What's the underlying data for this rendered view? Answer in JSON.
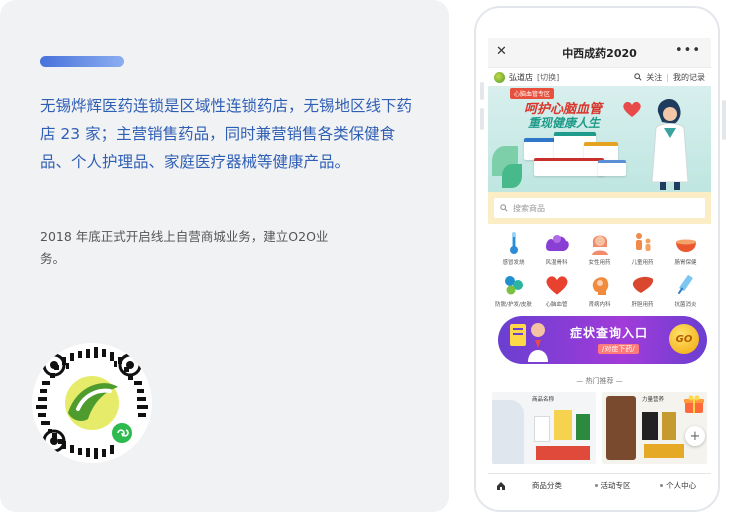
{
  "left_card": {
    "headline": "无锡烨辉医药连锁是区域性连锁药店，无锡地区线下药店 23 家；主营销售药品，同时兼营销售各类保健食品、个人护理品、家庭医疗器械等健康产品。",
    "subtext": "2018 年底正式开启线上自营商城业务，建立O2O业务。",
    "accent_color": "#2f5fb5"
  },
  "phone": {
    "nav": {
      "close_icon": "close-icon",
      "title": "中西成药2020",
      "more_icon": "more-icon"
    },
    "storebar": {
      "store_name": "弘道店",
      "switch_label": "[切换]",
      "follow_label": "关注",
      "records_label": "我的记录"
    },
    "banner": {
      "tag": "心脑血管专区",
      "line1": "呵护心脑血管",
      "line2": "重现健康人生"
    },
    "search": {
      "placeholder": "搜索商品"
    },
    "categories": [
      {
        "label": "感冒发烧",
        "icon": "thermometer-icon"
      },
      {
        "label": "风湿骨科",
        "icon": "muscle-icon"
      },
      {
        "label": "女性用药",
        "icon": "woman-icon"
      },
      {
        "label": "儿童用药",
        "icon": "family-icon"
      },
      {
        "label": "肠胃保健",
        "icon": "bowl-icon"
      },
      {
        "label": "防脱/护发/皮肤",
        "icon": "molecule-icon"
      },
      {
        "label": "心脑血管",
        "icon": "heart-icon"
      },
      {
        "label": "肾病内科",
        "icon": "head-icon"
      },
      {
        "label": "肝胆用药",
        "icon": "liver-icon"
      },
      {
        "label": "抗菌消炎",
        "icon": "syringe-icon"
      }
    ],
    "promo": {
      "title": "症状查询入口",
      "subtitle": "/对症下药/",
      "go_label": "GO"
    },
    "hot_title": "— 热门推荐 —",
    "products": [
      {
        "title": "商品名称"
      },
      {
        "title": "力量营养"
      }
    ],
    "tabbar": {
      "home_icon": "home-icon",
      "tab1": "商品分类",
      "tab2": "活动专区",
      "tab3": "个人中心"
    }
  }
}
